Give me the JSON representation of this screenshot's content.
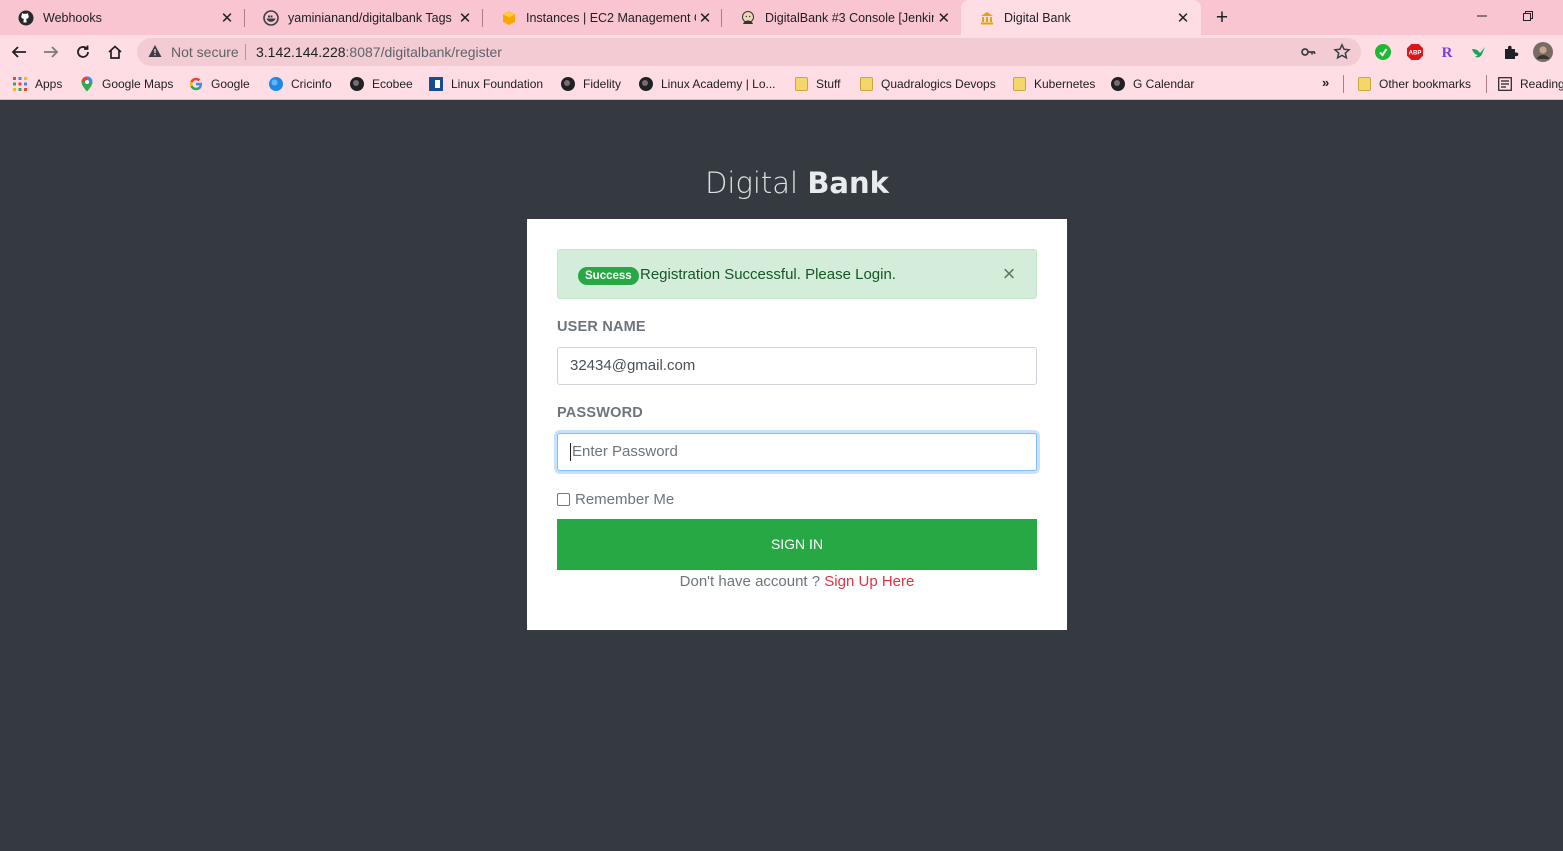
{
  "browser": {
    "tabs": [
      {
        "title": "Webhooks",
        "icon": "github-icon"
      },
      {
        "title": "yaminianand/digitalbank Tags",
        "icon": "docker-hub-icon"
      },
      {
        "title": "Instances | EC2 Management Con",
        "icon": "aws-icon"
      },
      {
        "title": "DigitalBank #3 Console [Jenkins]",
        "icon": "jenkins-icon"
      },
      {
        "title": "Digital Bank",
        "icon": "digital-bank-icon",
        "active": true
      }
    ],
    "new_tab": "+",
    "security_label": "Not secure",
    "url_host": "3.142.144.228",
    "url_path": ":8087/digitalbank/register",
    "bookmarks": [
      {
        "label": "Apps",
        "icon": "apps-grid-icon"
      },
      {
        "label": "Google Maps",
        "icon": "google-maps-icon"
      },
      {
        "label": "Google",
        "icon": "google-icon"
      },
      {
        "label": "Cricinfo",
        "icon": "cricinfo-icon"
      },
      {
        "label": "Ecobee",
        "icon": "globe-icon"
      },
      {
        "label": "Linux Foundation",
        "icon": "linux-foundation-icon"
      },
      {
        "label": "Fidelity",
        "icon": "globe-icon"
      },
      {
        "label": "Linux Academy | Lo...",
        "icon": "globe-icon"
      },
      {
        "label": "Stuff",
        "icon": "folder-icon"
      },
      {
        "label": "Quadralogics Devops",
        "icon": "folder-icon"
      },
      {
        "label": "Kubernetes",
        "icon": "folder-icon"
      },
      {
        "label": "G Calendar",
        "icon": "globe-icon"
      }
    ],
    "overflow": "»",
    "other_bookmarks": "Other bookmarks",
    "reading_list": "Reading"
  },
  "page": {
    "brand_light": "Digital",
    "brand_bold": "Bank",
    "alert": {
      "badge": "Success",
      "message": "Registration Successful. Please Login.",
      "close": "×"
    },
    "username_label": "USER NAME",
    "username_value": "32434@gmail.com",
    "password_label": "PASSWORD",
    "password_placeholder": "Enter Password",
    "remember_label": "Remember Me",
    "signin_label": "SIGN IN",
    "signup_prompt": "Don't have account ?",
    "signup_link": "Sign Up Here"
  },
  "colors": {
    "page_bg": "#343a40",
    "primary_green": "#28a745",
    "link_red": "#dc3545",
    "tab_strip": "#f9c5d0"
  }
}
